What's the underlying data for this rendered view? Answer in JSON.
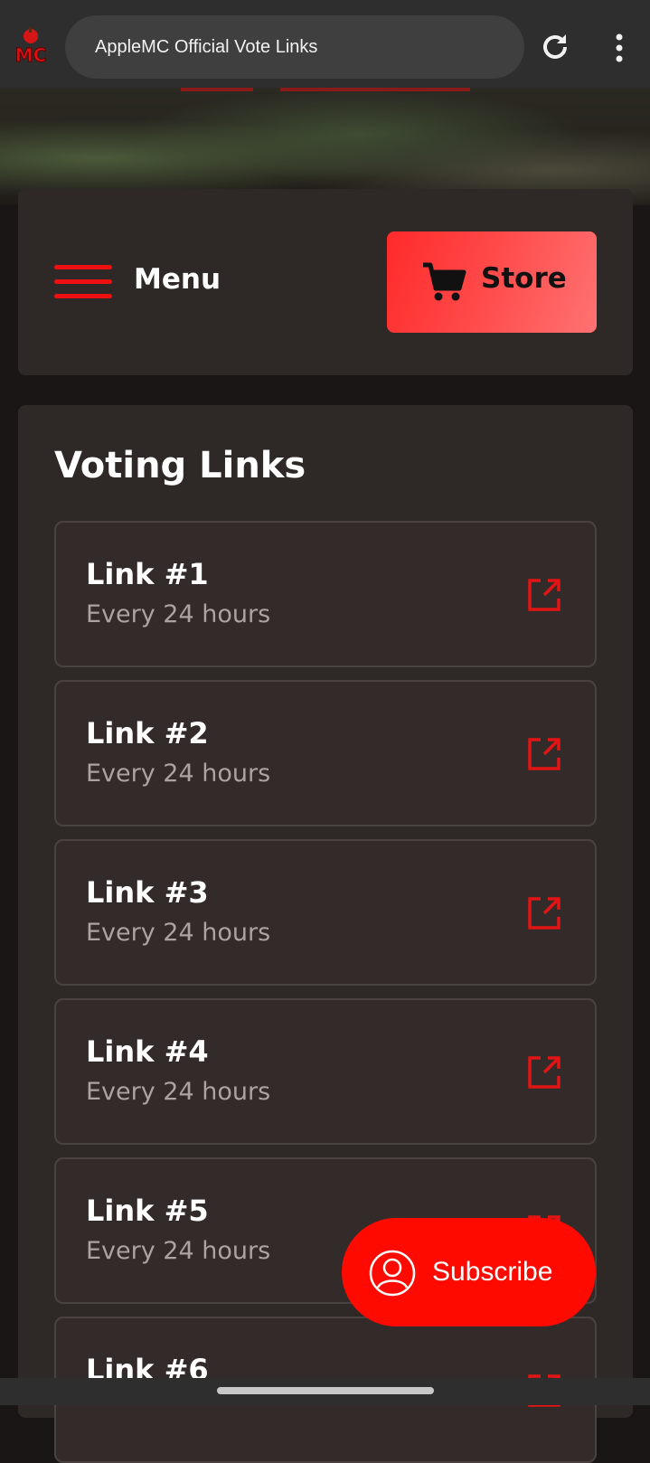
{
  "browser": {
    "page_title": "AppleMC Official Vote Links",
    "favicon": "applemc-logo-icon",
    "reload_icon": "reload-icon",
    "menu_icon": "more-vert-icon"
  },
  "header": {
    "menu_label": "Menu",
    "store_label": "Store",
    "accent_color": "#ee1111"
  },
  "voting": {
    "title": "Voting Links",
    "links": [
      {
        "title": "Link #1",
        "interval": "Every 24 hours"
      },
      {
        "title": "Link #2",
        "interval": "Every 24 hours"
      },
      {
        "title": "Link #3",
        "interval": "Every 24 hours"
      },
      {
        "title": "Link #4",
        "interval": "Every 24 hours"
      },
      {
        "title": "Link #5",
        "interval": "Every 24 hours"
      },
      {
        "title": "Link #6",
        "interval": ""
      }
    ]
  },
  "subscribe": {
    "label": "Subscribe",
    "color": "#ff0a00"
  }
}
